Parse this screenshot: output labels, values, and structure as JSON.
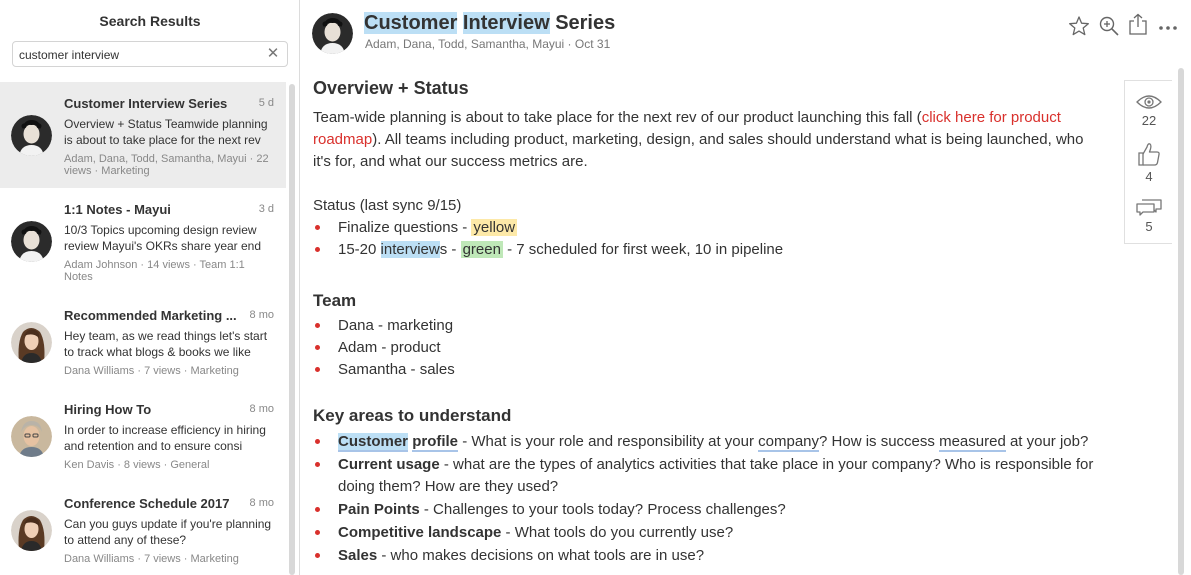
{
  "sidebar": {
    "title": "Search Results",
    "search": {
      "value": "customer interview",
      "clear_icon": "✕"
    },
    "results": [
      {
        "title": "Customer Interview Series",
        "date": "5 d",
        "snippet": "Overview + Status Teamwide planning is about to take place for the next rev",
        "meta": "Adam, Dana, Todd, Samantha, Mayui · 22 views · Marketing",
        "avatar": "man-curly"
      },
      {
        "title": "1:1 Notes - Mayui",
        "date": "3 d",
        "snippet": "10/3 Topics upcoming design review review Mayui's OKRs share year end",
        "meta": "Adam Johnson · 14 views · Team 1:1 Notes",
        "avatar": "man-curly"
      },
      {
        "title": "Recommended Marketing ...",
        "date": "8 mo",
        "snippet": "Hey team, as we read things let's start to track what blogs & books we like",
        "meta": "Dana Williams · 7 views · Marketing",
        "avatar": "woman-brown"
      },
      {
        "title": "Hiring How To",
        "date": "8 mo",
        "snippet": "In order to increase efficiency in hiring and retention and to ensure consi",
        "meta": "Ken Davis · 8 views · General",
        "avatar": "man-grey"
      },
      {
        "title": "Conference Schedule 2017",
        "date": "8 mo",
        "snippet": "Can you guys update if you're planning to attend any of these?",
        "meta": "Dana Williams · 7 views · Marketing",
        "avatar": "woman-brown"
      }
    ]
  },
  "doc": {
    "title_part1": "Customer",
    "title_part2": "Interview",
    "title_part3": "Series",
    "meta": "Adam, Dana, Todd, Samantha, Mayui · Oct 31",
    "overview_heading": "Overview + Status",
    "overview_text_1": "Team-wide planning is about to take place for the next rev of our product launching this fall (",
    "overview_link": "click here for product roadmap",
    "overview_text_2": "). All teams including product, marketing, design, and sales should understand what is being launched, who it's for, and what our success metrics are.",
    "status_label": "Status (last sync 9/15)",
    "status_items": [
      {
        "text": "Finalize questions - ",
        "tag": "yellow"
      },
      {
        "pre": "15-20 ",
        "hl": "interview",
        "mid": "s - ",
        "tag": "green",
        "post": " - 7 scheduled for first week, 10 in pipeline"
      }
    ],
    "team_heading": "Team",
    "team": [
      "Dana - marketing",
      "Adam - product",
      "Samantha - sales"
    ],
    "key_heading": "Key areas to understand",
    "key_items": [
      {
        "bold1": "Customer",
        "bold2": "profile",
        "text_a": " - What is your role and responsibility at your ",
        "u1": "company",
        "text_b": "? How is success ",
        "u2": "measured",
        "text_c": " at your job?"
      },
      {
        "bold": "Current usage",
        "text": " - what are the types of analytics activities that take place in your company? Who is responsible for doing them? How are they used?"
      },
      {
        "bold": "Pain Points",
        "text": " - Challenges to your tools today? Process challenges?"
      },
      {
        "bold": "Competitive landscape",
        "text": " - What tools do you currently use?"
      },
      {
        "bold": "Sales",
        "text": " - who makes decisions on what tools are in use?"
      }
    ]
  },
  "stats": {
    "views": "22",
    "likes": "4",
    "comments": "5"
  },
  "icons": {
    "top": [
      "star-icon",
      "zoom-icon",
      "share-icon",
      "more-icon"
    ]
  }
}
